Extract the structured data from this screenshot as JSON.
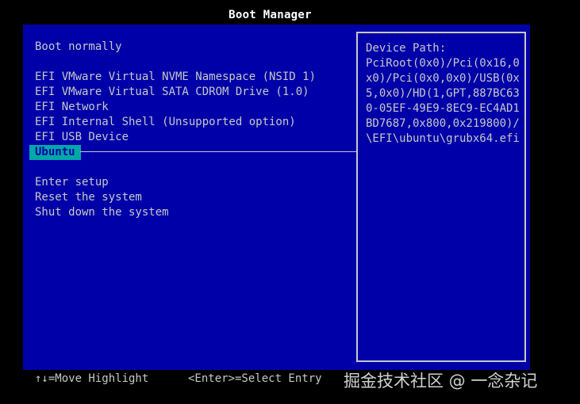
{
  "title": "Boot Manager",
  "menu": {
    "boot_normally": "Boot normally",
    "entries": [
      "EFI VMware Virtual NVME Namespace (NSID 1)",
      "EFI VMware Virtual SATA CDROM Drive (1.0)",
      "EFI Network",
      "EFI Internal Shell (Unsupported option)",
      "EFI USB Device"
    ],
    "selected": "Ubuntu",
    "actions": [
      "Enter setup",
      "Reset the system",
      "Shut down the system"
    ]
  },
  "info": {
    "label": "Device Path:",
    "value": "PciRoot(0x0)/Pci(0x16,0x0)/Pci(0x0,0x0)/USB(0x5,0x0)/HD(1,GPT,887BC630-05EF-49E9-8EC9-EC4AD1BD7687,0x800,0x219800)/\\EFI\\ubuntu\\grubx64.efi"
  },
  "footer": {
    "move_hint": "↑↓=Move Highlight",
    "select_hint": "<Enter>=Select Entry"
  },
  "watermark": "掘金技术社区 @ 一念杂记",
  "colors": {
    "background": "#000000",
    "panel": "#0000a8",
    "highlight": "#00a8a8",
    "text": "#c8c8c8",
    "title": "#ffffff"
  }
}
